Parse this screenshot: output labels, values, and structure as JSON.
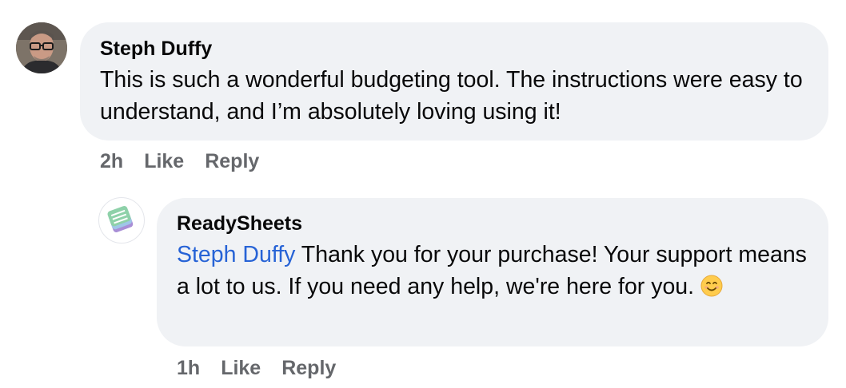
{
  "comment": {
    "author": "Steph Duffy",
    "text": "This is such a wonderful budgeting tool. The instructions were easy to understand, and I’m absolutely loving using it!",
    "time": "2h",
    "like_label": "Like",
    "reply_label": "Reply"
  },
  "reply": {
    "author": "ReadySheets",
    "mention": "Steph Duffy",
    "text": " Thank you for your purchase! Your support means a lot to us. If you need any help, we're here for you. ",
    "emoji": "smiling-face-icon",
    "time": "1h",
    "like_label": "Like",
    "reply_label": "Reply"
  },
  "colors": {
    "bubble": "#f0f2f5",
    "mention": "#2763d6",
    "secondary_text": "#65676b",
    "logo_accent": "#8ed1a9"
  }
}
